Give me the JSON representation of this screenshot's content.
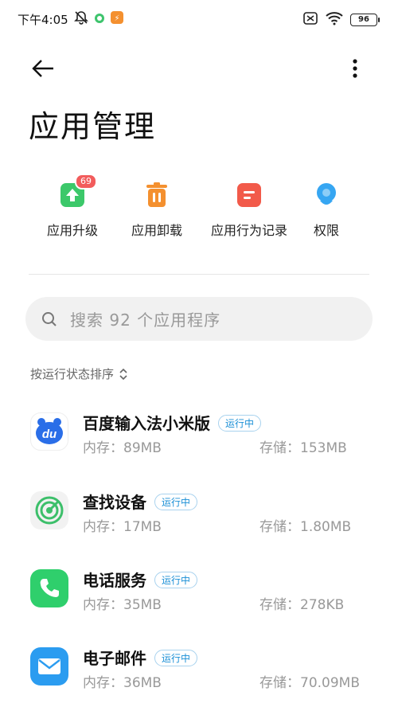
{
  "status_bar": {
    "time": "下午4:05",
    "battery": "96"
  },
  "header": {
    "title": "应用管理"
  },
  "quick_actions": [
    {
      "label": "应用升级",
      "icon": "upgrade-icon",
      "badge": "69",
      "color": "#3cc86a"
    },
    {
      "label": "应用卸载",
      "icon": "trash-icon",
      "color": "#f4902f"
    },
    {
      "label": "应用行为记录",
      "icon": "record-icon",
      "color": "#f25a4a"
    },
    {
      "label": "权限",
      "icon": "permission-icon",
      "color": "#36a6f2"
    }
  ],
  "search": {
    "placeholder": "搜索 92 个应用程序"
  },
  "sort": {
    "label": "按运行状态排序"
  },
  "apps": [
    {
      "name": "百度输入法小米版",
      "badge": "运行中",
      "memory": "内存：89MB",
      "storage": "存储：153MB",
      "icon": "baidu-ime-icon"
    },
    {
      "name": "查找设备",
      "badge": "运行中",
      "memory": "内存：17MB",
      "storage": "存储：1.80MB",
      "icon": "find-device-icon"
    },
    {
      "name": "电话服务",
      "badge": "运行中",
      "memory": "内存：35MB",
      "storage": "存储：278KB",
      "icon": "phone-icon"
    },
    {
      "name": "电子邮件",
      "badge": "运行中",
      "memory": "内存：36MB",
      "storage": "存储：70.09MB",
      "icon": "email-icon"
    }
  ]
}
